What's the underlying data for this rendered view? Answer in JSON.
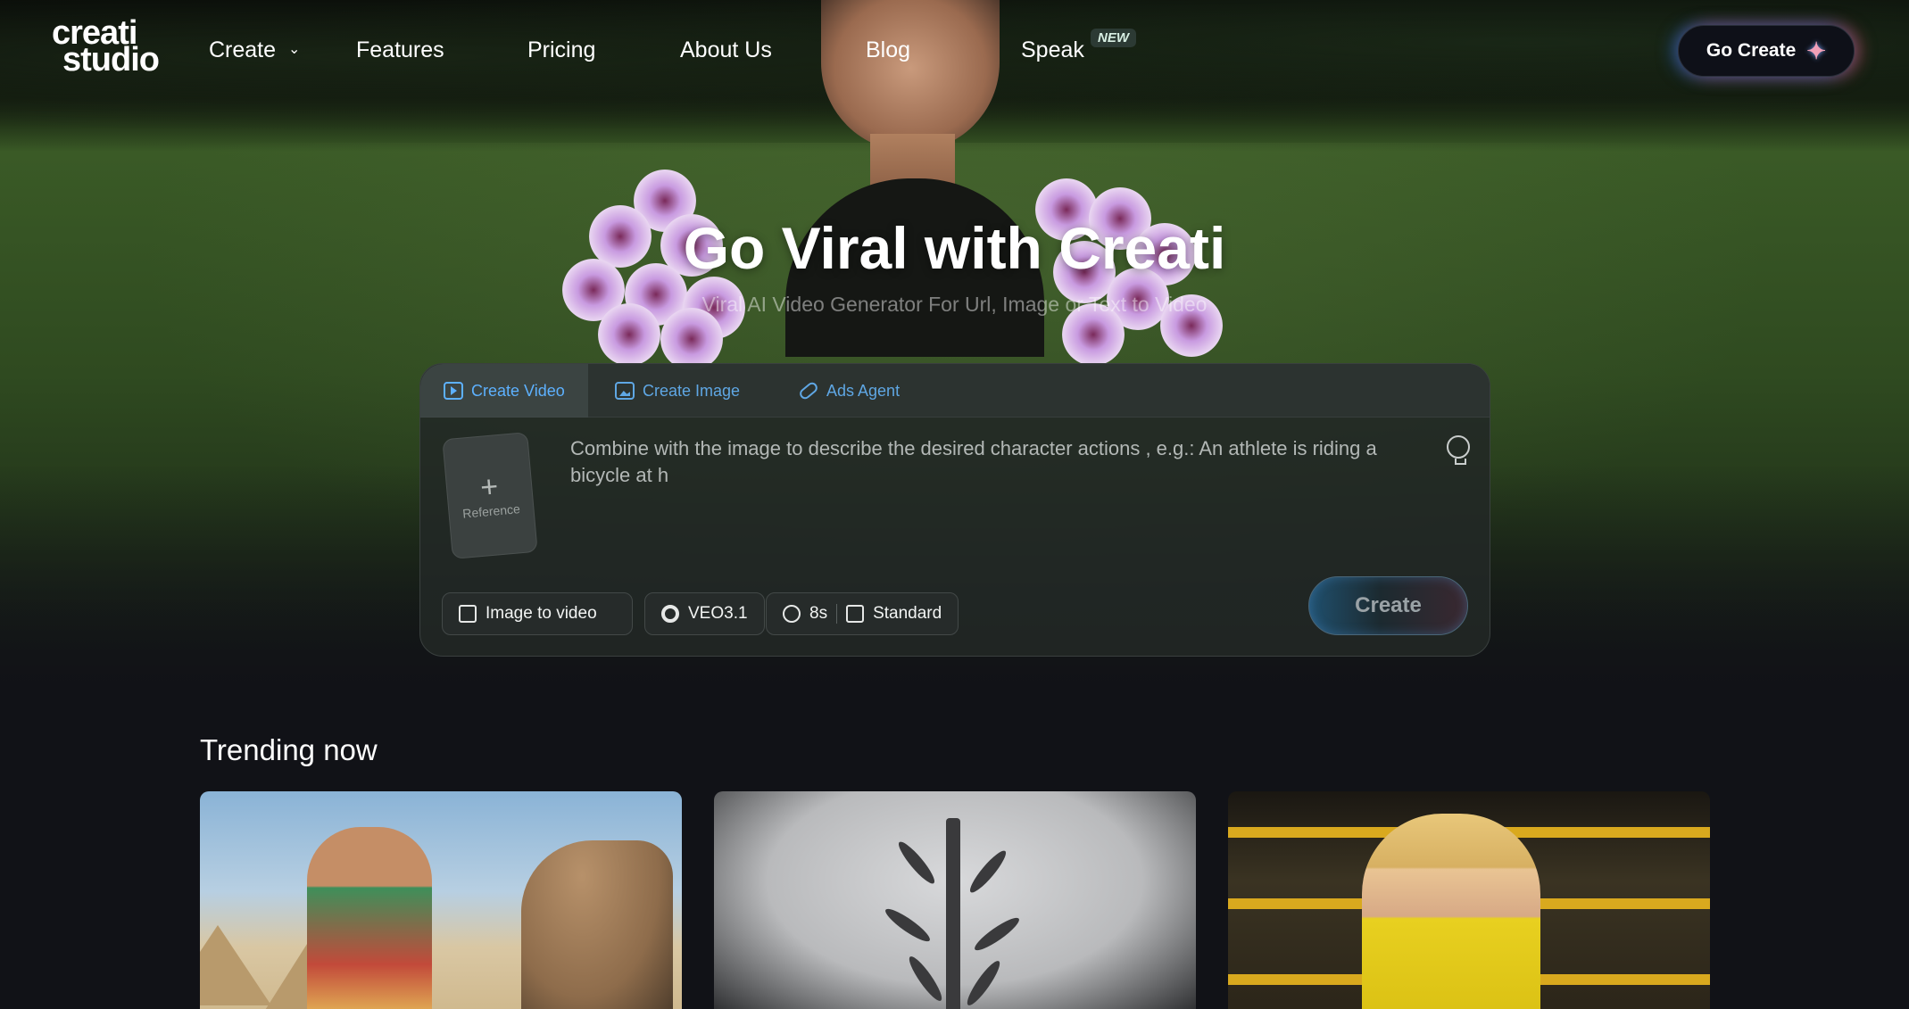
{
  "brand": {
    "line1": "creati",
    "line2": "studio"
  },
  "nav": {
    "items": [
      "Create",
      "Features",
      "Pricing",
      "About Us",
      "Blog",
      "Speak"
    ],
    "new_badge": "NEW",
    "cta": "Go Create"
  },
  "hero": {
    "title": "Go Viral with Creati",
    "subtitle": "Viral AI Video Generator For Url, Image or Text to Video"
  },
  "composer": {
    "tabs": [
      "Create Video",
      "Create Image",
      "Ads Agent"
    ],
    "active_tab": "Create Video",
    "reference_label": "Reference",
    "prompt_placeholder": "Combine with the image to describe the desired character actions , e.g.: An athlete is riding a bicycle at h",
    "options": {
      "mode": "Image to video",
      "model": "VEO3.1",
      "duration": "8s",
      "quality": "Standard"
    },
    "create_label": "Create"
  },
  "trending": {
    "title": "Trending now"
  },
  "colors": {
    "accent_blue": "#5db1ff",
    "cta_glow_blue": "#286edc",
    "cta_glow_pink": "#e65a78"
  }
}
